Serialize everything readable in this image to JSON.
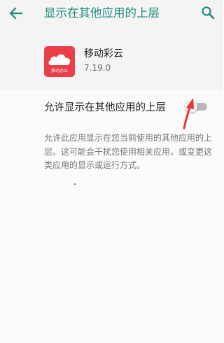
{
  "appbar": {
    "title": "显示在其他应用的上层",
    "accent_color": "#1b8c7e",
    "back_icon": "arrow-back-icon",
    "search_icon": "search-icon"
  },
  "app": {
    "name": "移动彩云",
    "version": "7.19.0",
    "icon_caption": "移动办公",
    "icon_color": "#ea3e4a"
  },
  "setting": {
    "label": "允许显示在其他应用的上层",
    "enabled": false
  },
  "description": "允许此应用显示在您当前使用的其他应用的上层。这可能会干扰您使用相关应用，或变更这类应用的显示或运行方式。",
  "annotation": {
    "arrow_color": "#e53935"
  }
}
